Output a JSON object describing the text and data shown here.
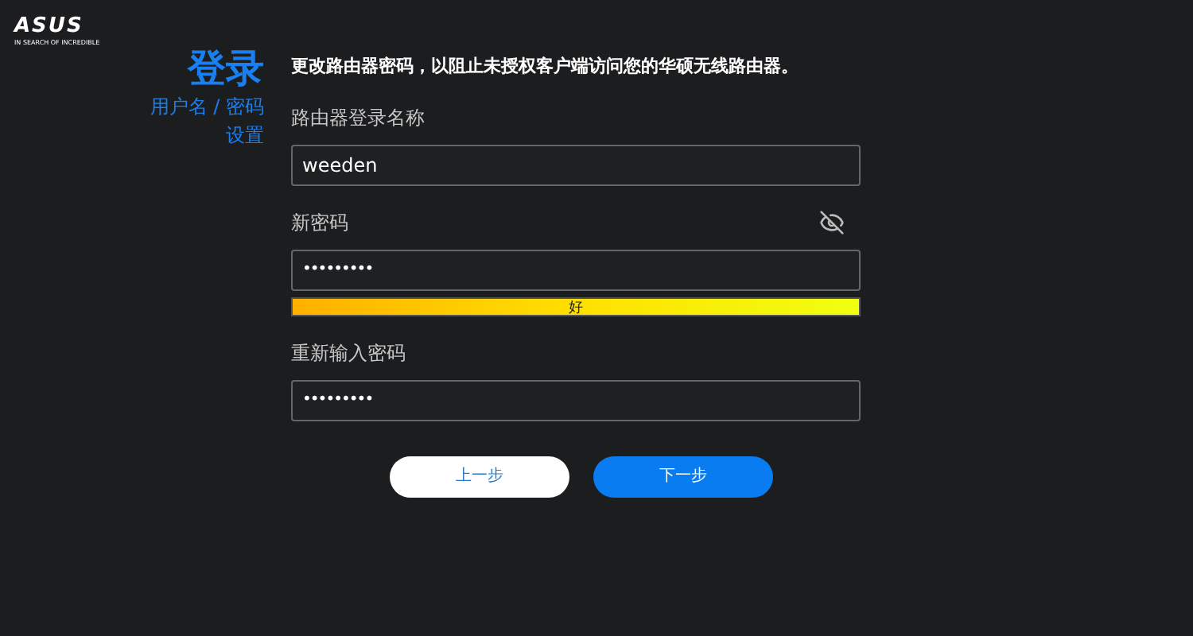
{
  "logo": {
    "brand": "ASUS",
    "tagline": "IN SEARCH OF INCREDIBLE"
  },
  "sidebar": {
    "title": "登录",
    "subtitle_lines": [
      "用户名 / 密码",
      "设置"
    ]
  },
  "intro": "更改路由器密码，以阻止未授权客户端访问您的华硕无线路由器。",
  "fields": [
    {
      "kind": "text",
      "label": "路由器登录名称",
      "value": "weeden"
    },
    {
      "kind": "password",
      "label": "新密码",
      "value": "•••••••••",
      "reveal_toggle": true,
      "strength": {
        "level": 1,
        "label": "好"
      }
    },
    {
      "kind": "password",
      "label": "重新输入密码",
      "value": "•••••••••"
    }
  ],
  "buttons": [
    {
      "label": "上一步",
      "kind": "secondary"
    },
    {
      "label": "下一步",
      "kind": "primary"
    }
  ]
}
